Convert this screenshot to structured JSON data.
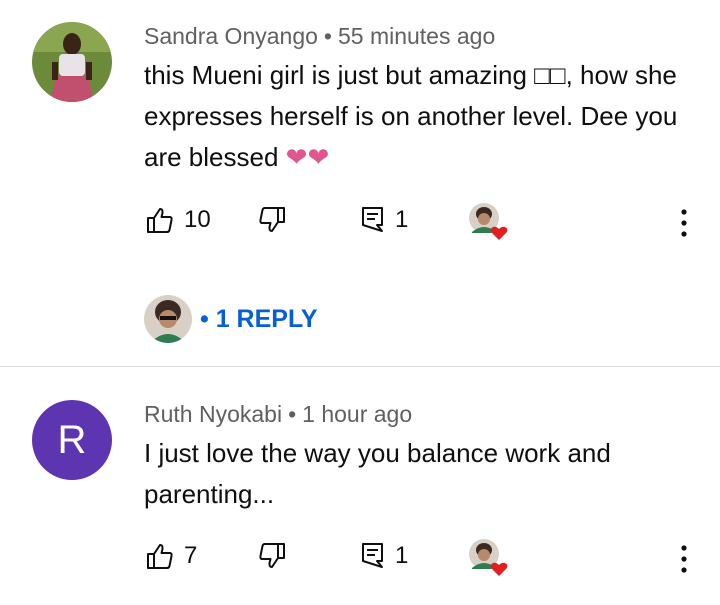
{
  "comments": [
    {
      "author": "Sandra Onyango",
      "time": "55 minutes ago",
      "text": "this Mueni girl is just but amazing □□, how she expresses herself is on another level. Dee you are blessed",
      "text_emoji": "❤❤",
      "likes": "10",
      "reply_count": "1",
      "replies_label": "• 1 REPLY"
    },
    {
      "author": "Ruth Nyokabi",
      "time": "1 hour ago",
      "avatar_letter": "R",
      "avatar_color": "#5e35b1",
      "text": "I just love the way you balance work and parenting...",
      "likes": "7",
      "reply_count": "1"
    }
  ],
  "separator": "•",
  "colors": {
    "link_blue": "#065fd4",
    "heart_red": "#e02020",
    "meta_gray": "#606060"
  }
}
